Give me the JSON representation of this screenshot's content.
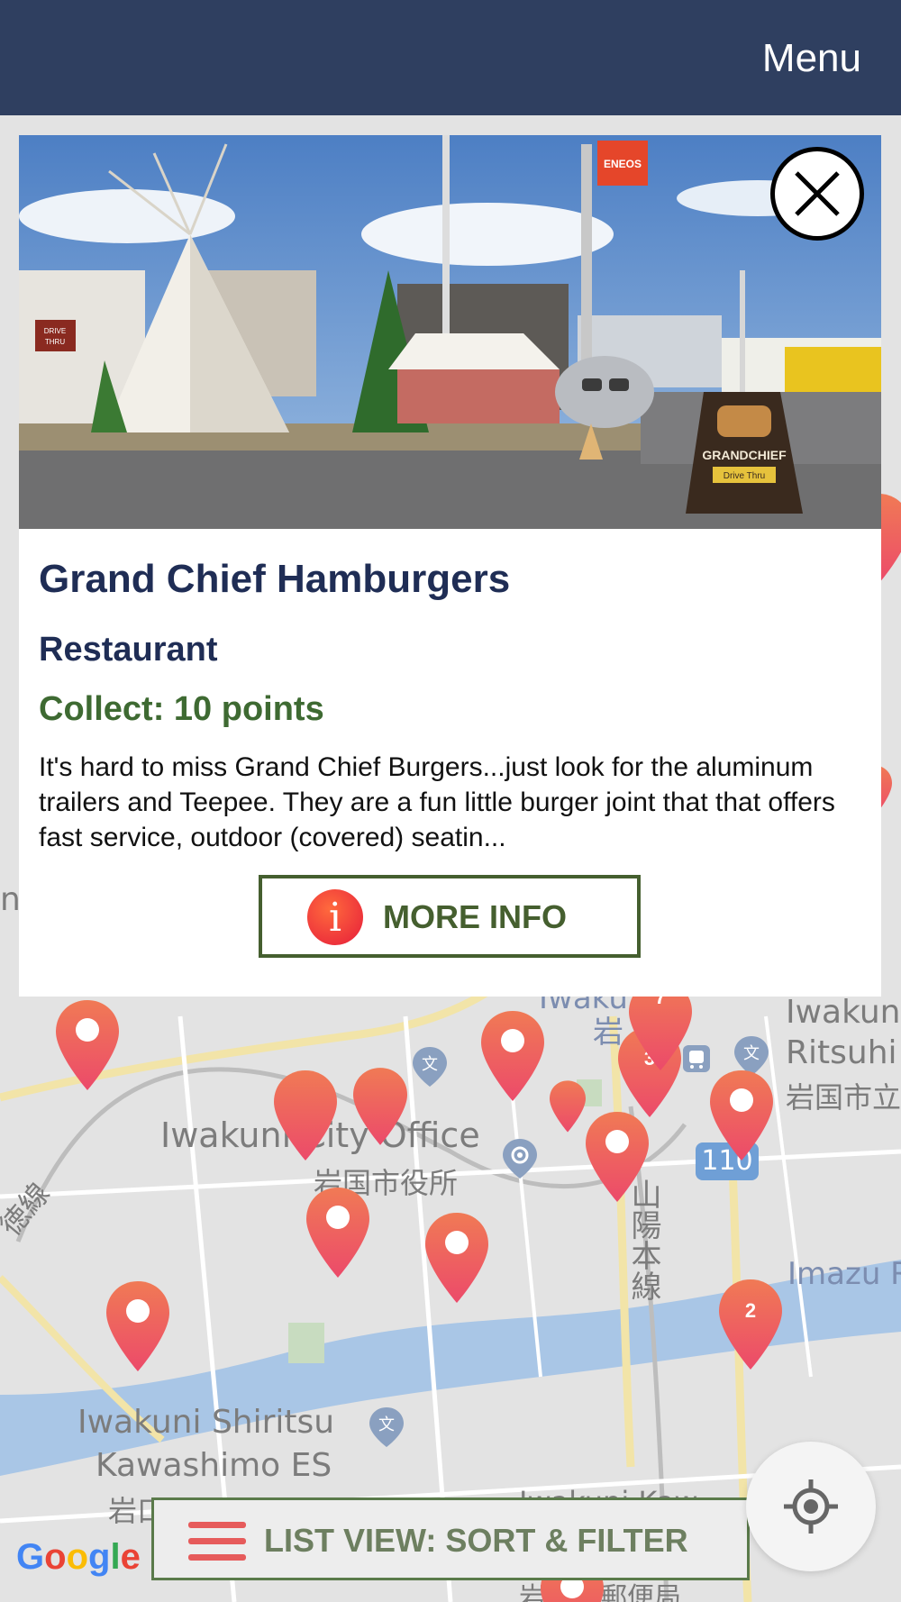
{
  "header": {
    "menu_label": "Menu"
  },
  "place": {
    "title": "Grand Chief Hamburgers",
    "category": "Restaurant",
    "collect": "Collect: 10 points",
    "description": "It's hard to miss Grand Chief Burgers...just look for the aluminum trailers and Teepee.  They are a fun little burger joint that that offers fast service, outdoor (covered) seatin...",
    "more_info_label": "MORE INFO",
    "photo_signs": {
      "eneos": "ENEOS",
      "drive_thru": "DRIVE THRU",
      "grand_chief": "GRANDCHIEF",
      "drive_thru_sign": "Drive Thru"
    }
  },
  "map": {
    "labels": {
      "iwakuni_top": "Iwaku",
      "iwakuni_ritsu_1": "Iwakun",
      "iwakuni_ritsu_2": "Ritsuhi",
      "iwakuni_ritsu_jp": "岩国市立",
      "city_office_en": "Iwakuni City Office",
      "city_office_jp": "岩国市役所",
      "sanyo_line": "山陽本線",
      "imazu": "Imazu R",
      "shiritsu_1": "Iwakuni Shiritsu",
      "shiritsu_2": "Kawashimo ES",
      "iwa_left": "岩口",
      "sen_left": "徳線",
      "kaw_bottom": "Iwakuni Kaw",
      "post_office": "岩国下郵便局",
      "iwa_jp_top": "岩",
      "edge_n": "n"
    },
    "route_badge": "110",
    "cluster_counts": [
      "3",
      "2",
      "7"
    ]
  },
  "bottom": {
    "list_view_label": "LIST VIEW: SORT & FILTER"
  },
  "google": {
    "letters": [
      "G",
      "o",
      "o",
      "g",
      "l",
      "e"
    ],
    "colors": [
      "#4285f4",
      "#ea4335",
      "#fbbc05",
      "#4285f4",
      "#34a853",
      "#ea4335"
    ]
  },
  "colors": {
    "header": "#2f3f60",
    "title": "#1f2d55",
    "collect": "#3e6a32",
    "pin": "#ee5a5a"
  }
}
